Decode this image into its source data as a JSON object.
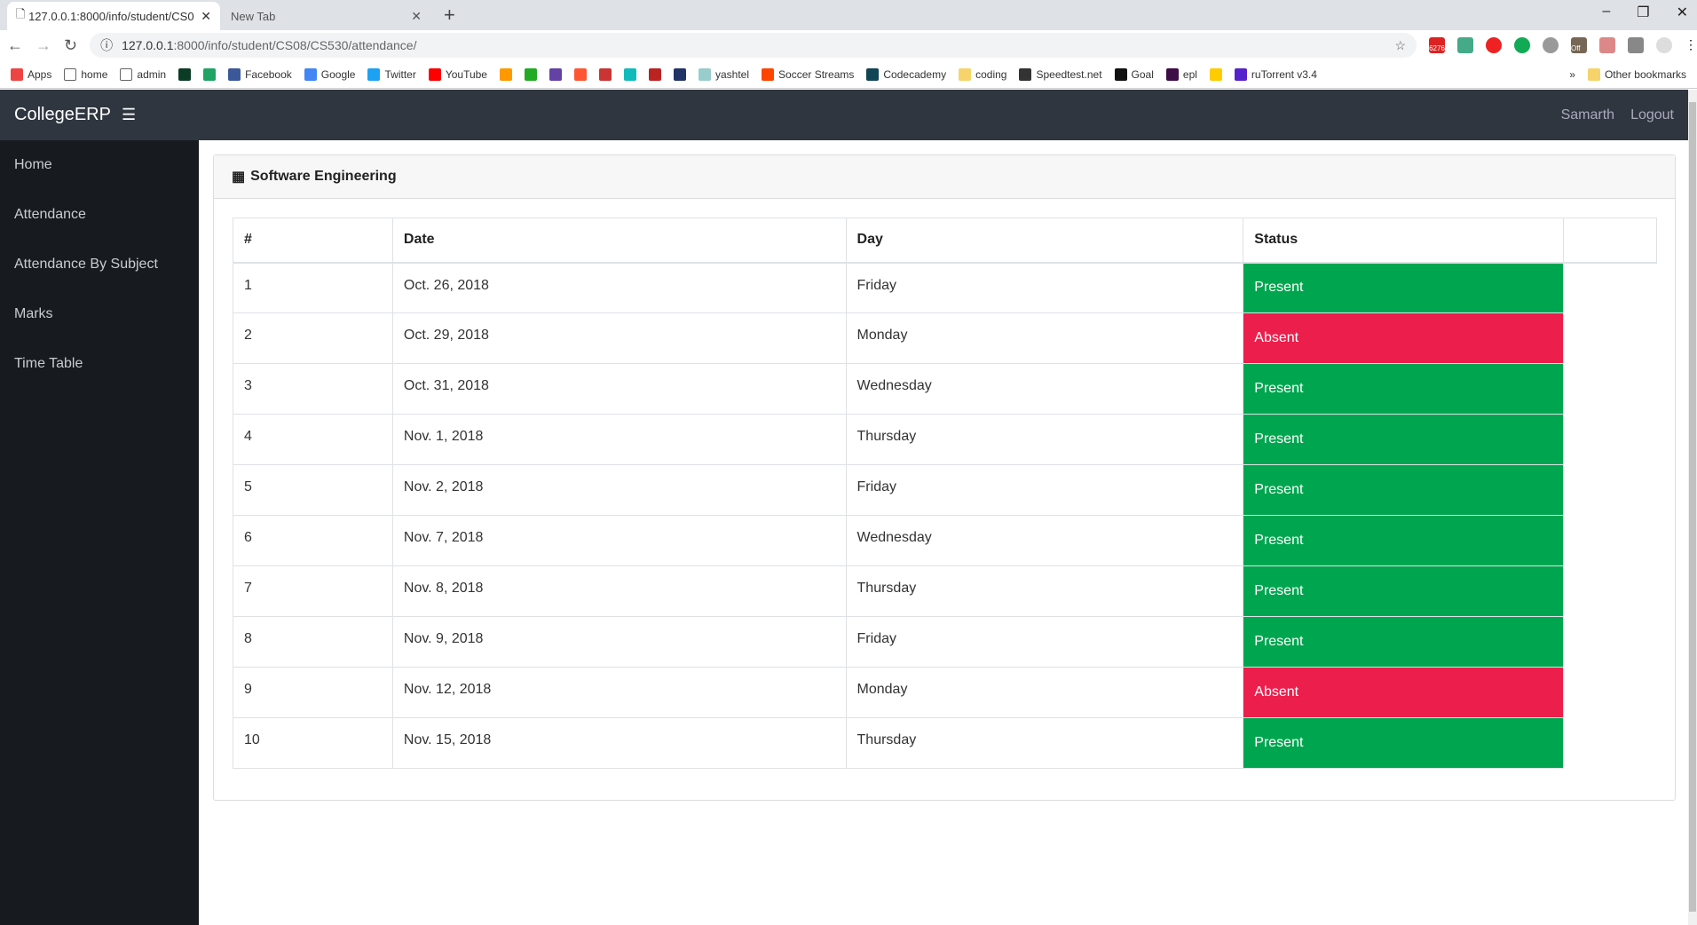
{
  "browser": {
    "tabs": [
      {
        "title": "127.0.0.1:8000/info/student/CS0"
      },
      {
        "title": "New Tab"
      }
    ],
    "url_host": "127.0.0.1",
    "url_rest": ":8000/info/student/CS08/CS530/attendance/",
    "extension_badges": [
      "6276",
      "Off"
    ],
    "bookmarks": [
      {
        "label": "Apps",
        "color": "#e44"
      },
      {
        "label": "home",
        "color": "#fff"
      },
      {
        "label": "admin",
        "color": "#fff"
      },
      {
        "label": "",
        "color": "#0c3c26"
      },
      {
        "label": "",
        "color": "#1fa463"
      },
      {
        "label": "Facebook",
        "color": "#3b5998"
      },
      {
        "label": "Google",
        "color": "#4285f4"
      },
      {
        "label": "Twitter",
        "color": "#1da1f2"
      },
      {
        "label": "YouTube",
        "color": "#f00"
      },
      {
        "label": "",
        "color": "#f90"
      },
      {
        "label": "",
        "color": "#2a2"
      },
      {
        "label": "",
        "color": "#6441a5"
      },
      {
        "label": "",
        "color": "#f53"
      },
      {
        "label": "",
        "color": "#c33"
      },
      {
        "label": "",
        "color": "#1bb"
      },
      {
        "label": "",
        "color": "#b22"
      },
      {
        "label": "",
        "color": "#236"
      },
      {
        "label": "yashtel",
        "color": "#9cc"
      },
      {
        "label": "Soccer Streams",
        "color": "#f40"
      },
      {
        "label": "Codecademy",
        "color": "#145"
      },
      {
        "label": "coding",
        "color": "#f6d36b"
      },
      {
        "label": "Speedtest.net",
        "color": "#333"
      },
      {
        "label": "Goal",
        "color": "#111"
      },
      {
        "label": "epl",
        "color": "#3d0d48"
      },
      {
        "label": "",
        "color": "#fc0"
      },
      {
        "label": "ruTorrent v3.4",
        "color": "#52c"
      }
    ],
    "other_bookmarks": "Other bookmarks"
  },
  "navbar": {
    "brand": "CollegeERP",
    "user": "Samarth",
    "logout": "Logout"
  },
  "sidebar": {
    "items": [
      {
        "label": "Home"
      },
      {
        "label": "Attendance"
      },
      {
        "label": "Attendance By Subject"
      },
      {
        "label": "Marks"
      },
      {
        "label": "Time Table"
      }
    ]
  },
  "card": {
    "title": "Software Engineering"
  },
  "colors": {
    "present": "#00a64f",
    "absent": "#ec1e4c"
  },
  "table": {
    "headers": [
      "#",
      "Date",
      "Day",
      "Status"
    ],
    "rows": [
      {
        "n": "1",
        "date": "Oct. 26, 2018",
        "day": "Friday",
        "status": "Present"
      },
      {
        "n": "2",
        "date": "Oct. 29, 2018",
        "day": "Monday",
        "status": "Absent"
      },
      {
        "n": "3",
        "date": "Oct. 31, 2018",
        "day": "Wednesday",
        "status": "Present"
      },
      {
        "n": "4",
        "date": "Nov. 1, 2018",
        "day": "Thursday",
        "status": "Present"
      },
      {
        "n": "5",
        "date": "Nov. 2, 2018",
        "day": "Friday",
        "status": "Present"
      },
      {
        "n": "6",
        "date": "Nov. 7, 2018",
        "day": "Wednesday",
        "status": "Present"
      },
      {
        "n": "7",
        "date": "Nov. 8, 2018",
        "day": "Thursday",
        "status": "Present"
      },
      {
        "n": "8",
        "date": "Nov. 9, 2018",
        "day": "Friday",
        "status": "Present"
      },
      {
        "n": "9",
        "date": "Nov. 12, 2018",
        "day": "Monday",
        "status": "Absent"
      },
      {
        "n": "10",
        "date": "Nov. 15, 2018",
        "day": "Thursday",
        "status": "Present"
      }
    ]
  }
}
